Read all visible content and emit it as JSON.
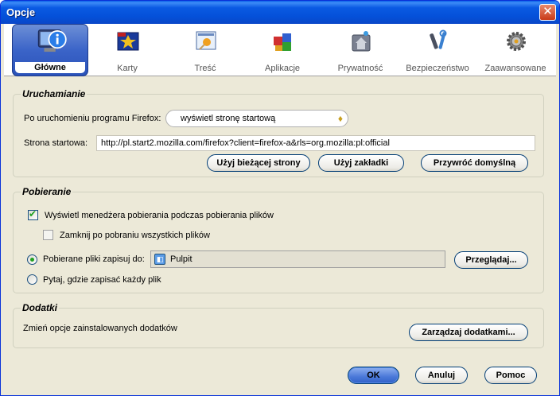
{
  "window": {
    "title": "Opcje",
    "close": "✕"
  },
  "panes": [
    {
      "label": "Główne",
      "icon": "general-icon",
      "selected": true
    },
    {
      "label": "Karty",
      "icon": "tabs-icon"
    },
    {
      "label": "Treść",
      "icon": "content-icon"
    },
    {
      "label": "Aplikacje",
      "icon": "applications-icon"
    },
    {
      "label": "Prywatność",
      "icon": "privacy-icon"
    },
    {
      "label": "Bezpieczeństwo",
      "icon": "security-icon"
    },
    {
      "label": "Zaawansowane",
      "icon": "advanced-icon"
    }
  ],
  "startup": {
    "title": "Uruchamianie",
    "when_label": "Po uruchomieniu programu Firefox:",
    "when_value": "wyświetl stronę startową",
    "home_label": "Strona startowa:",
    "home_value": "http://pl.start2.mozilla.com/firefox?client=firefox-a&rls=org.mozilla:pl:official",
    "use_current": "Użyj bieżącej strony",
    "use_bookmark": "Użyj zakładki",
    "restore_default": "Przywróć domyślną"
  },
  "downloads": {
    "title": "Pobieranie",
    "show_manager": "Wyświetl menedżera pobierania podczas pobierania plików",
    "close_when_done": "Zamknij po pobraniu wszystkich plików",
    "save_to": "Pobierane pliki zapisuj do:",
    "folder": "Pulpit",
    "browse": "Przeglądaj...",
    "ask_each": "Pytaj, gdzie zapisać każdy plik"
  },
  "addons": {
    "title": "Dodatki",
    "desc": "Zmień opcje zainstalowanych dodatków",
    "manage": "Zarządzaj dodatkami..."
  },
  "footer": {
    "ok": "OK",
    "cancel": "Anuluj",
    "help": "Pomoc"
  }
}
